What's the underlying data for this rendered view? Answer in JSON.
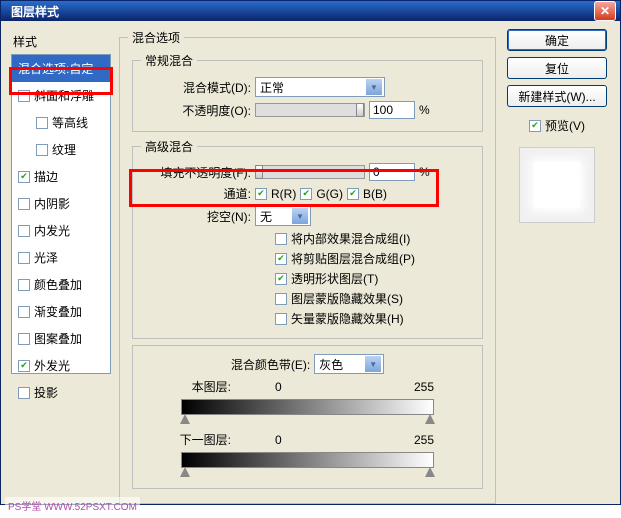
{
  "title": "图层样式",
  "left": {
    "header": "样式",
    "items": [
      {
        "label": "混合选项:自定",
        "selected": true
      },
      {
        "label": "斜面和浮雕",
        "checked": false
      },
      {
        "label": "等高线",
        "checked": false,
        "indent": true
      },
      {
        "label": "纹理",
        "checked": false,
        "indent": true
      },
      {
        "label": "描边",
        "checked": true
      },
      {
        "label": "内阴影",
        "checked": false
      },
      {
        "label": "内发光",
        "checked": false
      },
      {
        "label": "光泽",
        "checked": false
      },
      {
        "label": "颜色叠加",
        "checked": false
      },
      {
        "label": "渐变叠加",
        "checked": false
      },
      {
        "label": "图案叠加",
        "checked": false
      },
      {
        "label": "外发光",
        "checked": true
      },
      {
        "label": "投影",
        "checked": false
      }
    ]
  },
  "mid": {
    "title": "混合选项",
    "normal": {
      "title": "常规混合",
      "mode_label": "混合模式(D):",
      "mode_value": "正常",
      "opacity_label": "不透明度(O):",
      "opacity_value": "100",
      "pct": "%"
    },
    "adv": {
      "title": "高级混合",
      "fill_label": "填充不透明度(F):",
      "fill_value": "0",
      "pct": "%",
      "channels_label": "通道:",
      "ch_r": "R(R)",
      "ch_g": "G(G)",
      "ch_b": "B(B)",
      "knockout_label": "挖空(N):",
      "knockout_value": "无",
      "opts": [
        {
          "label": "将内部效果混合成组(I)",
          "checked": false
        },
        {
          "label": "将剪贴图层混合成组(P)",
          "checked": true
        },
        {
          "label": "透明形状图层(T)",
          "checked": true
        },
        {
          "label": "图层蒙版隐藏效果(S)",
          "checked": false
        },
        {
          "label": "矢量蒙版隐藏效果(H)",
          "checked": false
        }
      ]
    },
    "blendif": {
      "label": "混合颜色带(E):",
      "value": "灰色",
      "this_label": "本图层:",
      "this_min": "0",
      "this_max": "255",
      "under_label": "下一图层:",
      "under_min": "0",
      "under_max": "255"
    }
  },
  "right": {
    "ok": "确定",
    "cancel": "复位",
    "newstyle": "新建样式(W)...",
    "preview": "预览(V)"
  },
  "watermark": "PS学堂  WWW.52PSXT.COM"
}
